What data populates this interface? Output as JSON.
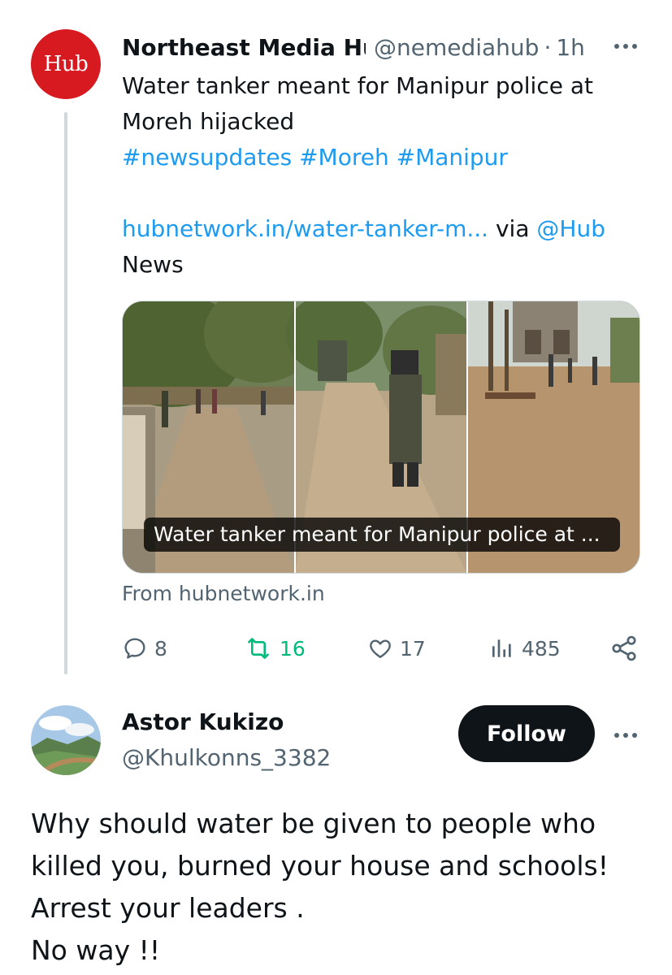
{
  "tweet": {
    "avatar_text": "Hub",
    "author_name": "Northeast Media Hub",
    "handle": "@nemediahub",
    "separator": "·",
    "time": "1h",
    "text_line1": "Water tanker meant for Manipur police at",
    "text_line2": "Moreh hijacked",
    "hashtags": [
      {
        "label": "#newsupdates"
      },
      {
        "label": "#Moreh"
      },
      {
        "label": "#Manipur"
      }
    ],
    "link_text": "hubnetwork.in/water-tanker-m...",
    "via_text": "via",
    "mention": "@Hub",
    "trailing_word": "News",
    "card": {
      "caption": "Water tanker meant for Manipur police at ...",
      "source": "From hubnetwork.in"
    },
    "stats": {
      "replies": "8",
      "reposts": "16",
      "likes": "17",
      "views": "485"
    }
  },
  "reply": {
    "author_name": "Astor Kukizo",
    "handle": "@Khulkonns_3382",
    "follow_label": "Follow",
    "lines": [
      {
        "text": "Why should water be given to people who"
      },
      {
        "text": "killed you, burned your house and schools!"
      },
      {
        "text": "Arrest your leaders ."
      },
      {
        "text": "No way !!"
      }
    ]
  },
  "colors": {
    "link": "#1d9bf0",
    "secondary_text": "#536471",
    "repost_green": "#00ba7c",
    "hub_red": "#d71920",
    "follow_bg": "#0f1419"
  },
  "icons": [
    "more-icon",
    "reply-icon",
    "repost-icon",
    "like-icon",
    "views-icon",
    "share-icon"
  ]
}
